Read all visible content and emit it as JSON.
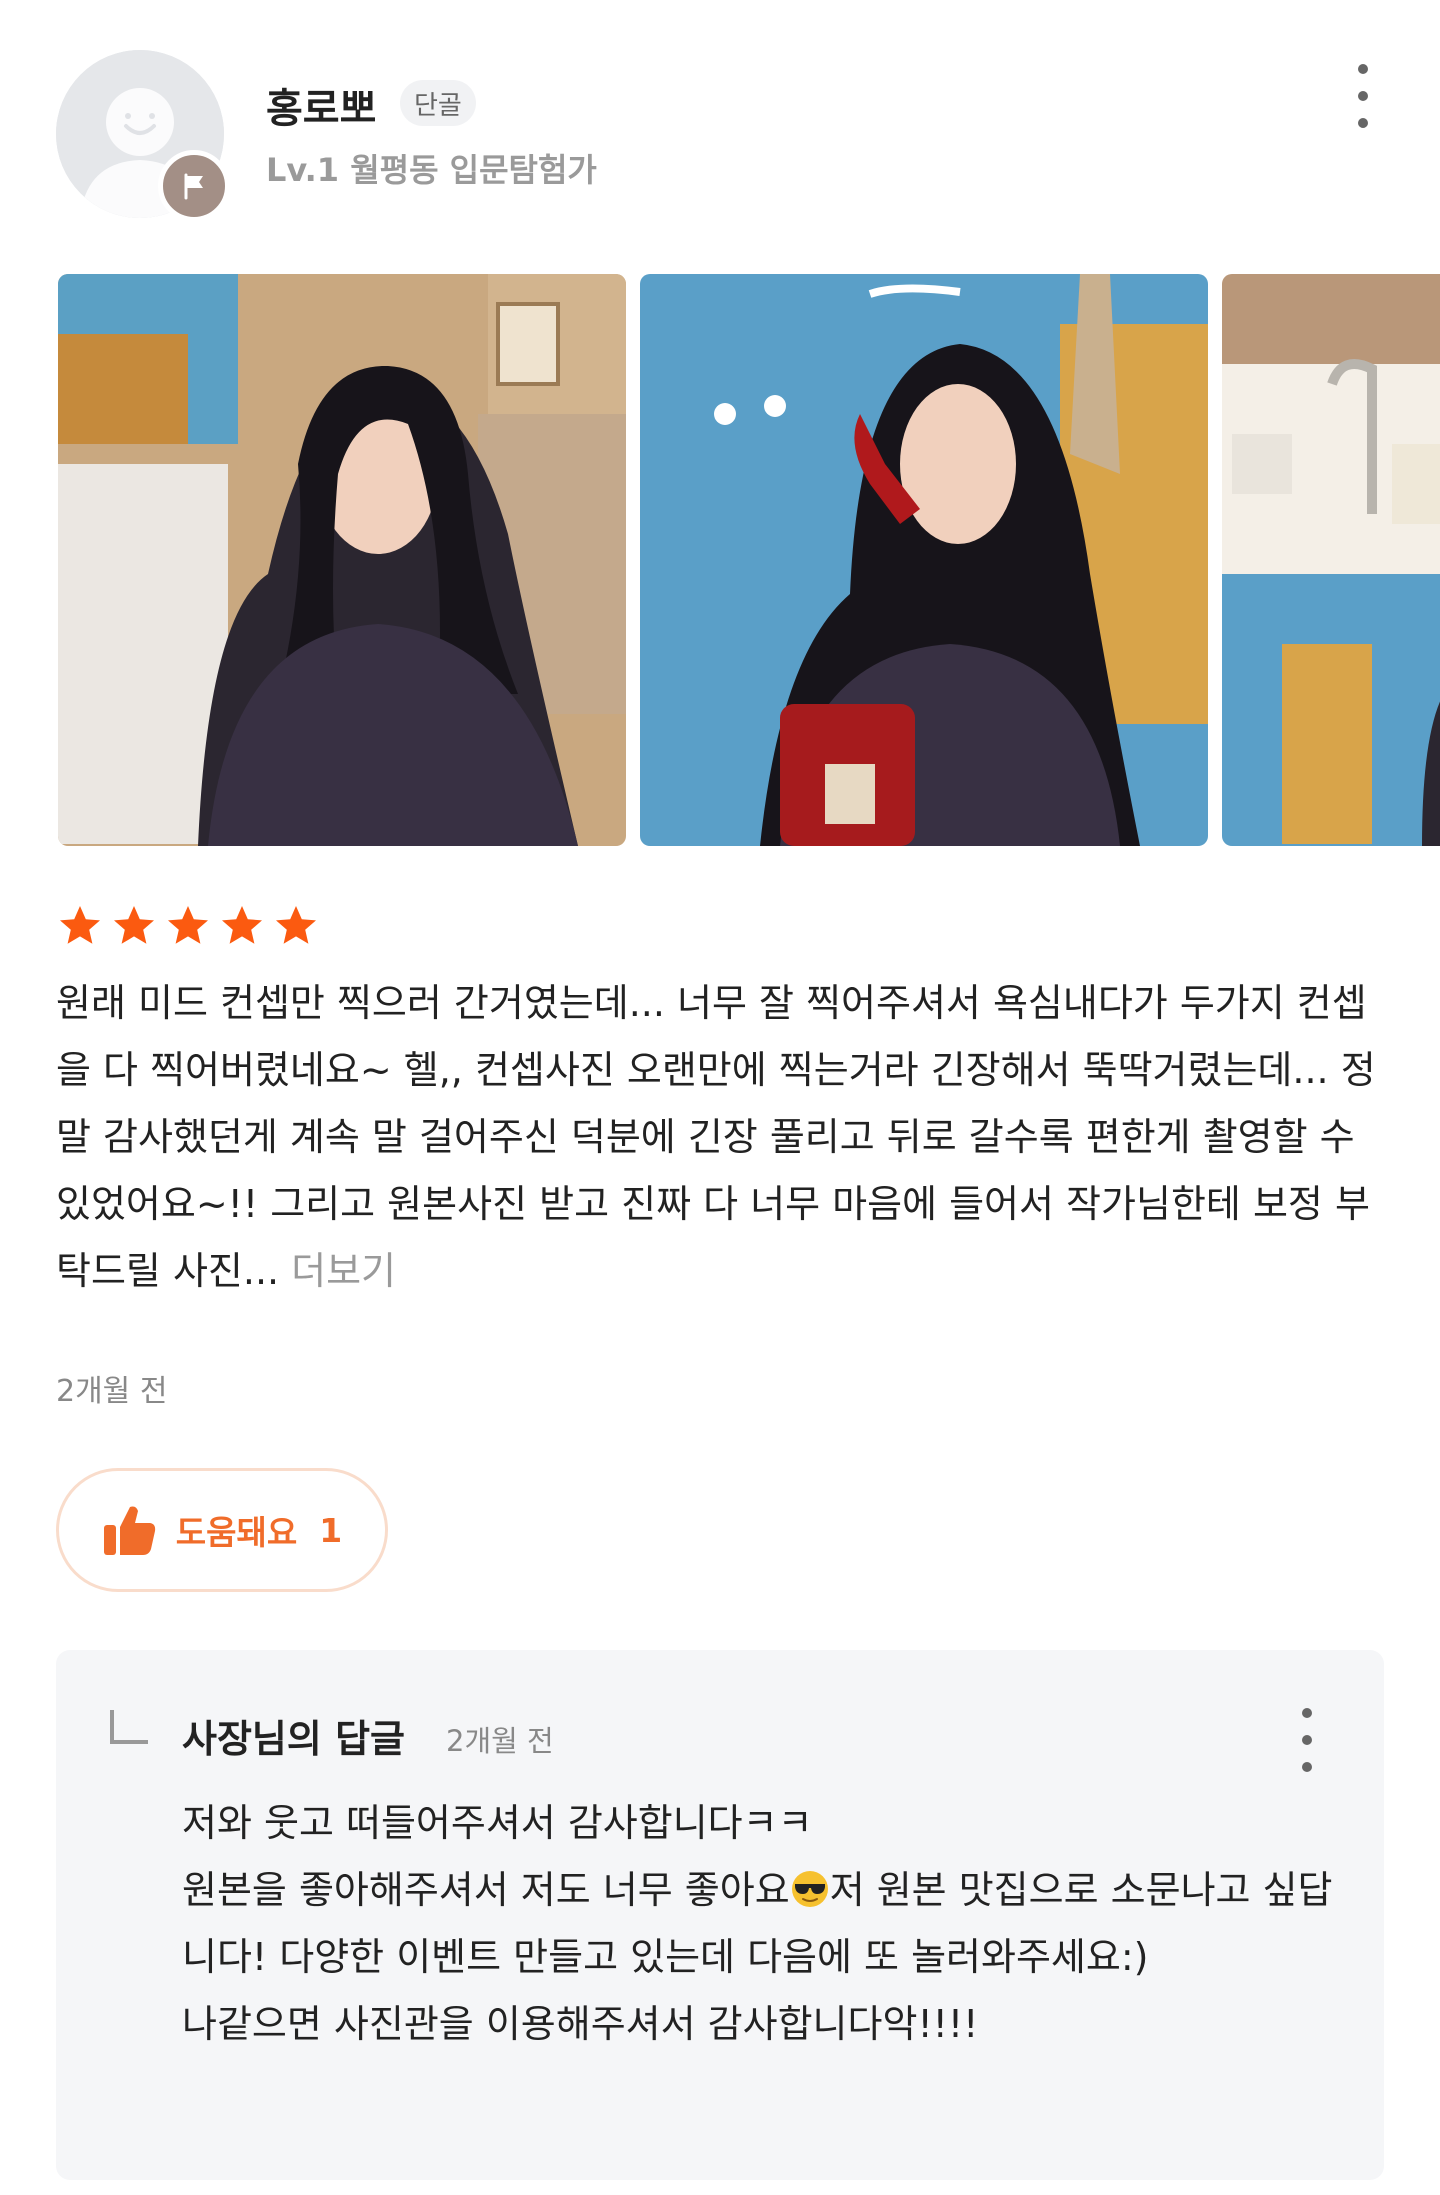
{
  "reviewer": {
    "name": "홍로뽀",
    "badge": "단골",
    "level": "Lv.1 월평동 입문탐험가"
  },
  "photos": [
    {
      "alt": "photo-1"
    },
    {
      "alt": "photo-2"
    },
    {
      "alt": "photo-3"
    }
  ],
  "rating": 5,
  "review": {
    "text": "원래 미드 컨셉만 찍으러 간거였는데... 너무 잘 찍어주셔서 욕심내다가 두가지 컨셉을 다 찍어버렸네요~ 헬,, 컨셉사진 오랜만에 찍는거라 긴장해서 뚝딱거렸는데... 정말 감사했던게 계속 말 걸어주신 덕분에 긴장 풀리고 뒤로 갈수록 편한게 촬영할 수 있었어요~!! 그리고 원본사진 받고 진짜 다 너무 마음에 들어서 작가님한테 보정 부탁드릴 사진...",
    "more_label": "더보기",
    "date": "2개월 전"
  },
  "helpful": {
    "label": "도움돼요",
    "count": "1"
  },
  "owner_reply": {
    "author": "사장님의 답글",
    "date": "2개월 전",
    "line1": "저와 웃고 떠들어주셔서 감사합니다ㅋㅋ",
    "line2a": "원본을 좋아해주셔서 저도 너무 좋아요",
    "line2b": "저 원본 맛집으로 소문나고 싶답니다! 다양한 이벤트 만들고 있는데 다음에 또 놀러와주세요:)",
    "line3": "나같으면 사진관을 이용해주셔서 감사합니다악!!!!"
  },
  "colors": {
    "accent": "#f06c2a",
    "star": "#fb5a10",
    "reply_bg": "#f5f6f8"
  }
}
